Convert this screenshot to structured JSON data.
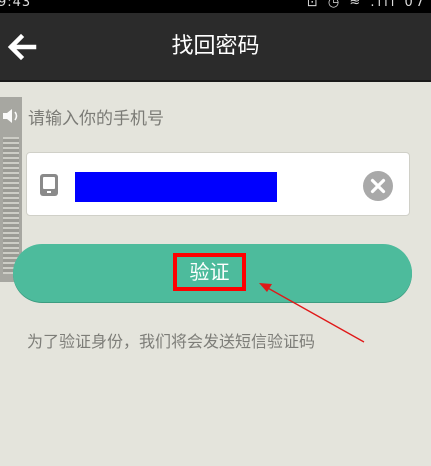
{
  "status_bar": {
    "time": "9:43",
    "indicators": "⊡ ◷ ≈ .ıll 07"
  },
  "header": {
    "back_icon": "arrow-left-icon",
    "title": "找回密码"
  },
  "form": {
    "prompt": "请输入你的手机号",
    "phone_icon": "mobile-phone-icon",
    "phone_value": "",
    "clear_icon": "clear-x-icon",
    "verify_label": "验证",
    "note": "为了验证身份，我们将会发送短信验证码"
  },
  "colors": {
    "header_bg": "#2b2b2b",
    "page_bg": "#e4e4dc",
    "button_green": "#4dbb9c",
    "highlight_red": "#ff0000",
    "redacted_blue": "#0000ff"
  }
}
